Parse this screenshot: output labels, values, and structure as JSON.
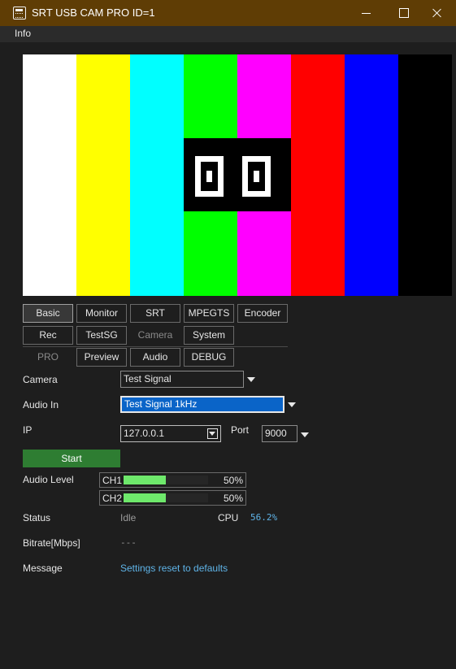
{
  "window": {
    "title": "SRT USB CAM PRO ID=1"
  },
  "menu": {
    "info": "Info"
  },
  "preview": {
    "bar_colors": [
      "#ffffff",
      "#ffff00",
      "#00ffff",
      "#00ff00",
      "#ff00ff",
      "#ff0000",
      "#0000ff",
      "#000000"
    ],
    "counter": "00"
  },
  "tabs": {
    "row1": [
      "Basic",
      "Monitor",
      "SRT",
      "MPEGTS",
      "Encoder"
    ],
    "row2": [
      "Rec",
      "TestSG",
      "Camera",
      "System"
    ],
    "row3": [
      "PRO",
      "Preview",
      "Audio",
      "DEBUG"
    ],
    "active": "Basic"
  },
  "form": {
    "camera_label": "Camera",
    "camera_value": "Test Signal",
    "audio_in_label": "Audio In",
    "audio_in_value": "Test Signal 1kHz",
    "ip_label": "IP",
    "ip_value": "127.0.0.1",
    "port_label": "Port",
    "port_value": "9000",
    "start_label": "Start"
  },
  "audio_level": {
    "label": "Audio Level",
    "channels": [
      {
        "name": "CH1",
        "level": 0.5,
        "percent_text": "50%"
      },
      {
        "name": "CH2",
        "level": 0.5,
        "percent_text": "50%"
      }
    ]
  },
  "status": {
    "label": "Status",
    "value": "Idle",
    "cpu_label": "CPU",
    "cpu_value": "56.2%",
    "bitrate_label": "Bitrate[Mbps]",
    "bitrate_value": "---",
    "message_label": "Message",
    "message_value": "Settings reset to defaults"
  },
  "colors": {
    "titlebar": "#5f3d05",
    "start_button": "#2e7d32",
    "meter_fill": "#6ee86b",
    "accent_text": "#5fb4e8",
    "selection": "#0a64c8"
  }
}
